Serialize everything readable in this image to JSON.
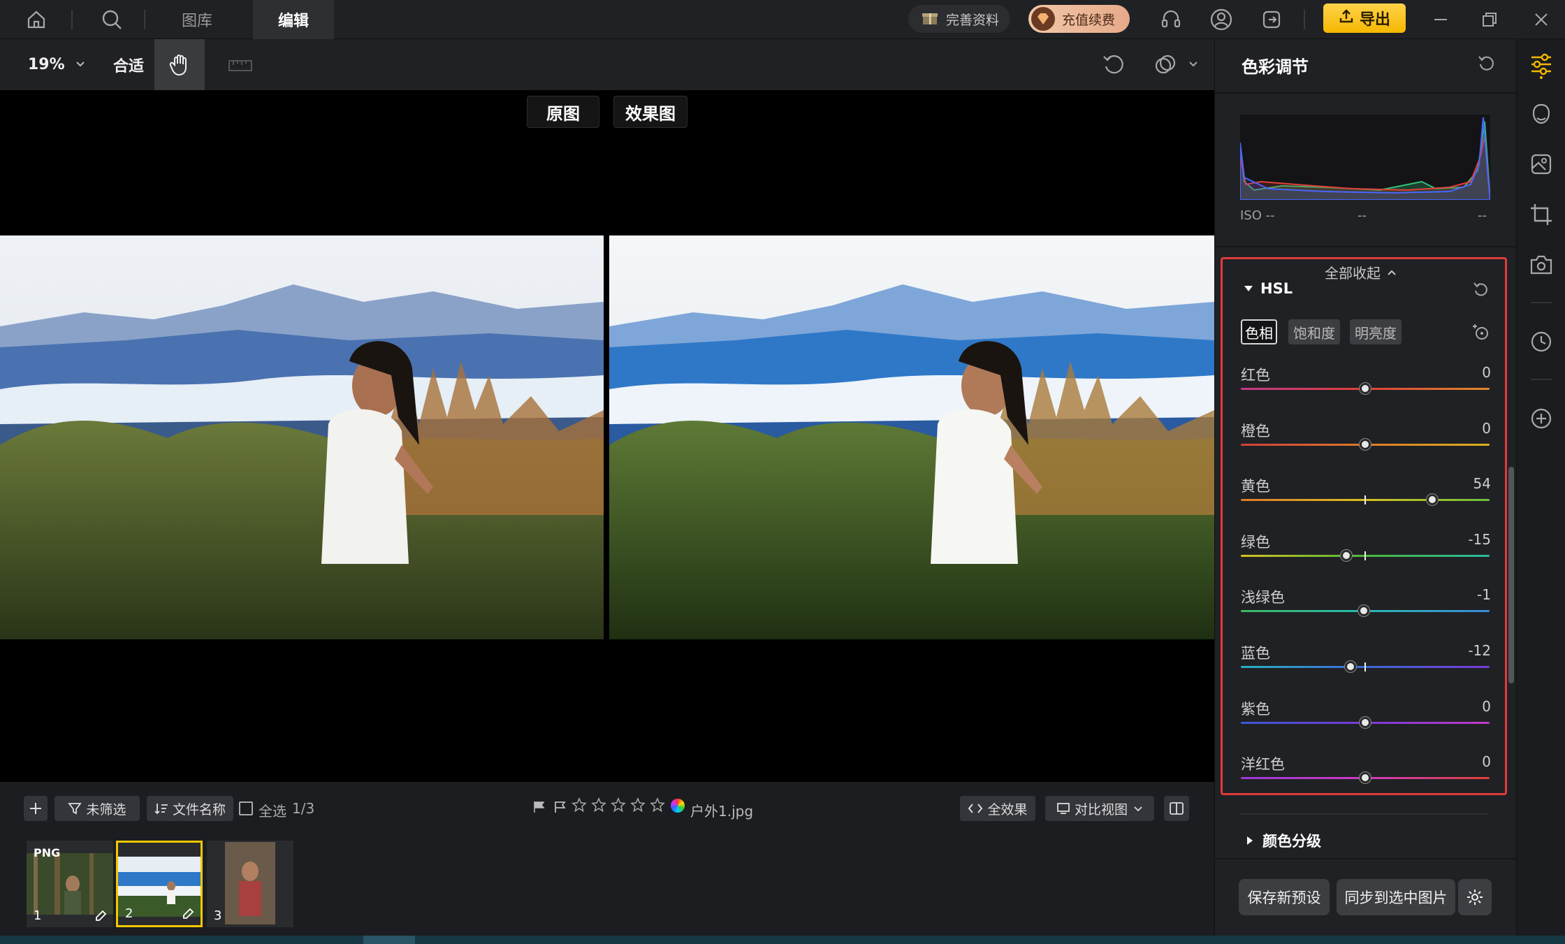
{
  "topbar": {
    "tab_library": "图库",
    "tab_edit": "编辑",
    "complete_profile": "完善资料",
    "recharge": "充值续费",
    "export": "导出"
  },
  "toolbar": {
    "zoom": "19%",
    "fit": "合适"
  },
  "compare": {
    "original": "原图",
    "effect": "效果图"
  },
  "bottombar": {
    "unfiltered": "未筛选",
    "file_name": "文件名称",
    "select_all": "全选",
    "count": "1/3",
    "filename": "户外1.jpg",
    "full_effect": "全效果",
    "compare_view": "对比视图"
  },
  "thumbnails": [
    {
      "number": "1",
      "badge": "PNG"
    },
    {
      "number": "2",
      "badge": ""
    },
    {
      "number": "3",
      "badge": ""
    }
  ],
  "panel": {
    "title": "色彩调节",
    "iso": "ISO --",
    "mid": "--",
    "right": "--",
    "collapse_all": "全部收起",
    "section": "HSL",
    "tabs": [
      "色相",
      "饱和度",
      "明亮度"
    ],
    "sliders": [
      {
        "label": "红色",
        "value": "0",
        "num": 0
      },
      {
        "label": "橙色",
        "value": "0",
        "num": 0
      },
      {
        "label": "黄色",
        "value": "54",
        "num": 54
      },
      {
        "label": "绿色",
        "value": "-15",
        "num": -15
      },
      {
        "label": "浅绿色",
        "value": "-1",
        "num": -1
      },
      {
        "label": "蓝色",
        "value": "-12",
        "num": -12
      },
      {
        "label": "紫色",
        "value": "0",
        "num": 0
      },
      {
        "label": "洋红色",
        "value": "0",
        "num": 0
      }
    ],
    "next_section": "颜色分级",
    "save_preset": "保存新预设",
    "sync": "同步到选中图片"
  },
  "colors": {
    "accent": "#f5b800",
    "highlight_box": "#e03b3b"
  }
}
